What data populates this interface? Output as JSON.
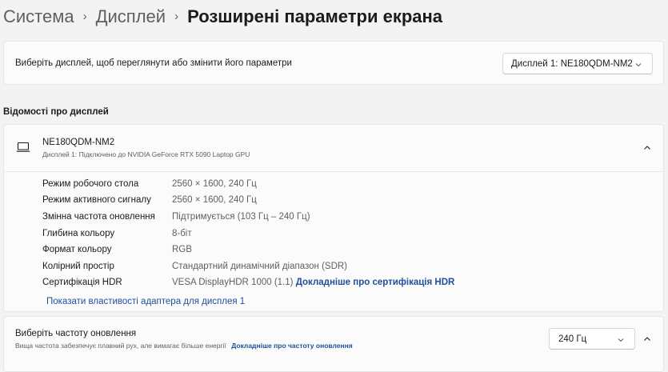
{
  "breadcrumb": {
    "items": [
      "Система",
      "Дисплей"
    ],
    "separator": "›",
    "current": "Розширені параметри екрана"
  },
  "display_select": {
    "label": "Виберіть дисплей, щоб переглянути або змінити його параметри",
    "selected": "Дисплей 1: NE180QDM-NM2"
  },
  "info_section": {
    "title": "Відомості про дисплей",
    "monitor_name": "NE180QDM-NM2",
    "monitor_subtitle": "Дисплей 1: Підключено до NVIDIA GeForce RTX 5090 Laptop GPU",
    "rows": [
      {
        "key": "Режим робочого стола",
        "value": "2560 × 1600, 240 Гц"
      },
      {
        "key": "Режим активного сигналу",
        "value": "2560 × 1600, 240 Гц"
      },
      {
        "key": "Змінна частота оновлення",
        "value": "Підтримується (103 Гц – 240 Гц)"
      },
      {
        "key": "Глибина кольору",
        "value": "8-біт"
      },
      {
        "key": "Формат кольору",
        "value": "RGB"
      },
      {
        "key": "Колірний простір",
        "value": "Стандартний динамічний діапазон (SDR)"
      },
      {
        "key": "Сертифікація HDR",
        "value": "VESA DisplayHDR 1000 (1.1)",
        "link": "Докладніше про сертифікація HDR"
      }
    ],
    "adapter_link": "Показати властивості адаптера для дисплея 1"
  },
  "refresh": {
    "title": "Виберіть частоту оновлення",
    "subtitle": "Вища частота забезпечує плавний рух, але вимагає більше енергії",
    "link": "Докладніше про частоту оновлення",
    "selected": "240 Гц"
  },
  "colors": {
    "background": "#f3f3f3",
    "card": "#fbfbfb",
    "link": "#1f4e9a"
  }
}
